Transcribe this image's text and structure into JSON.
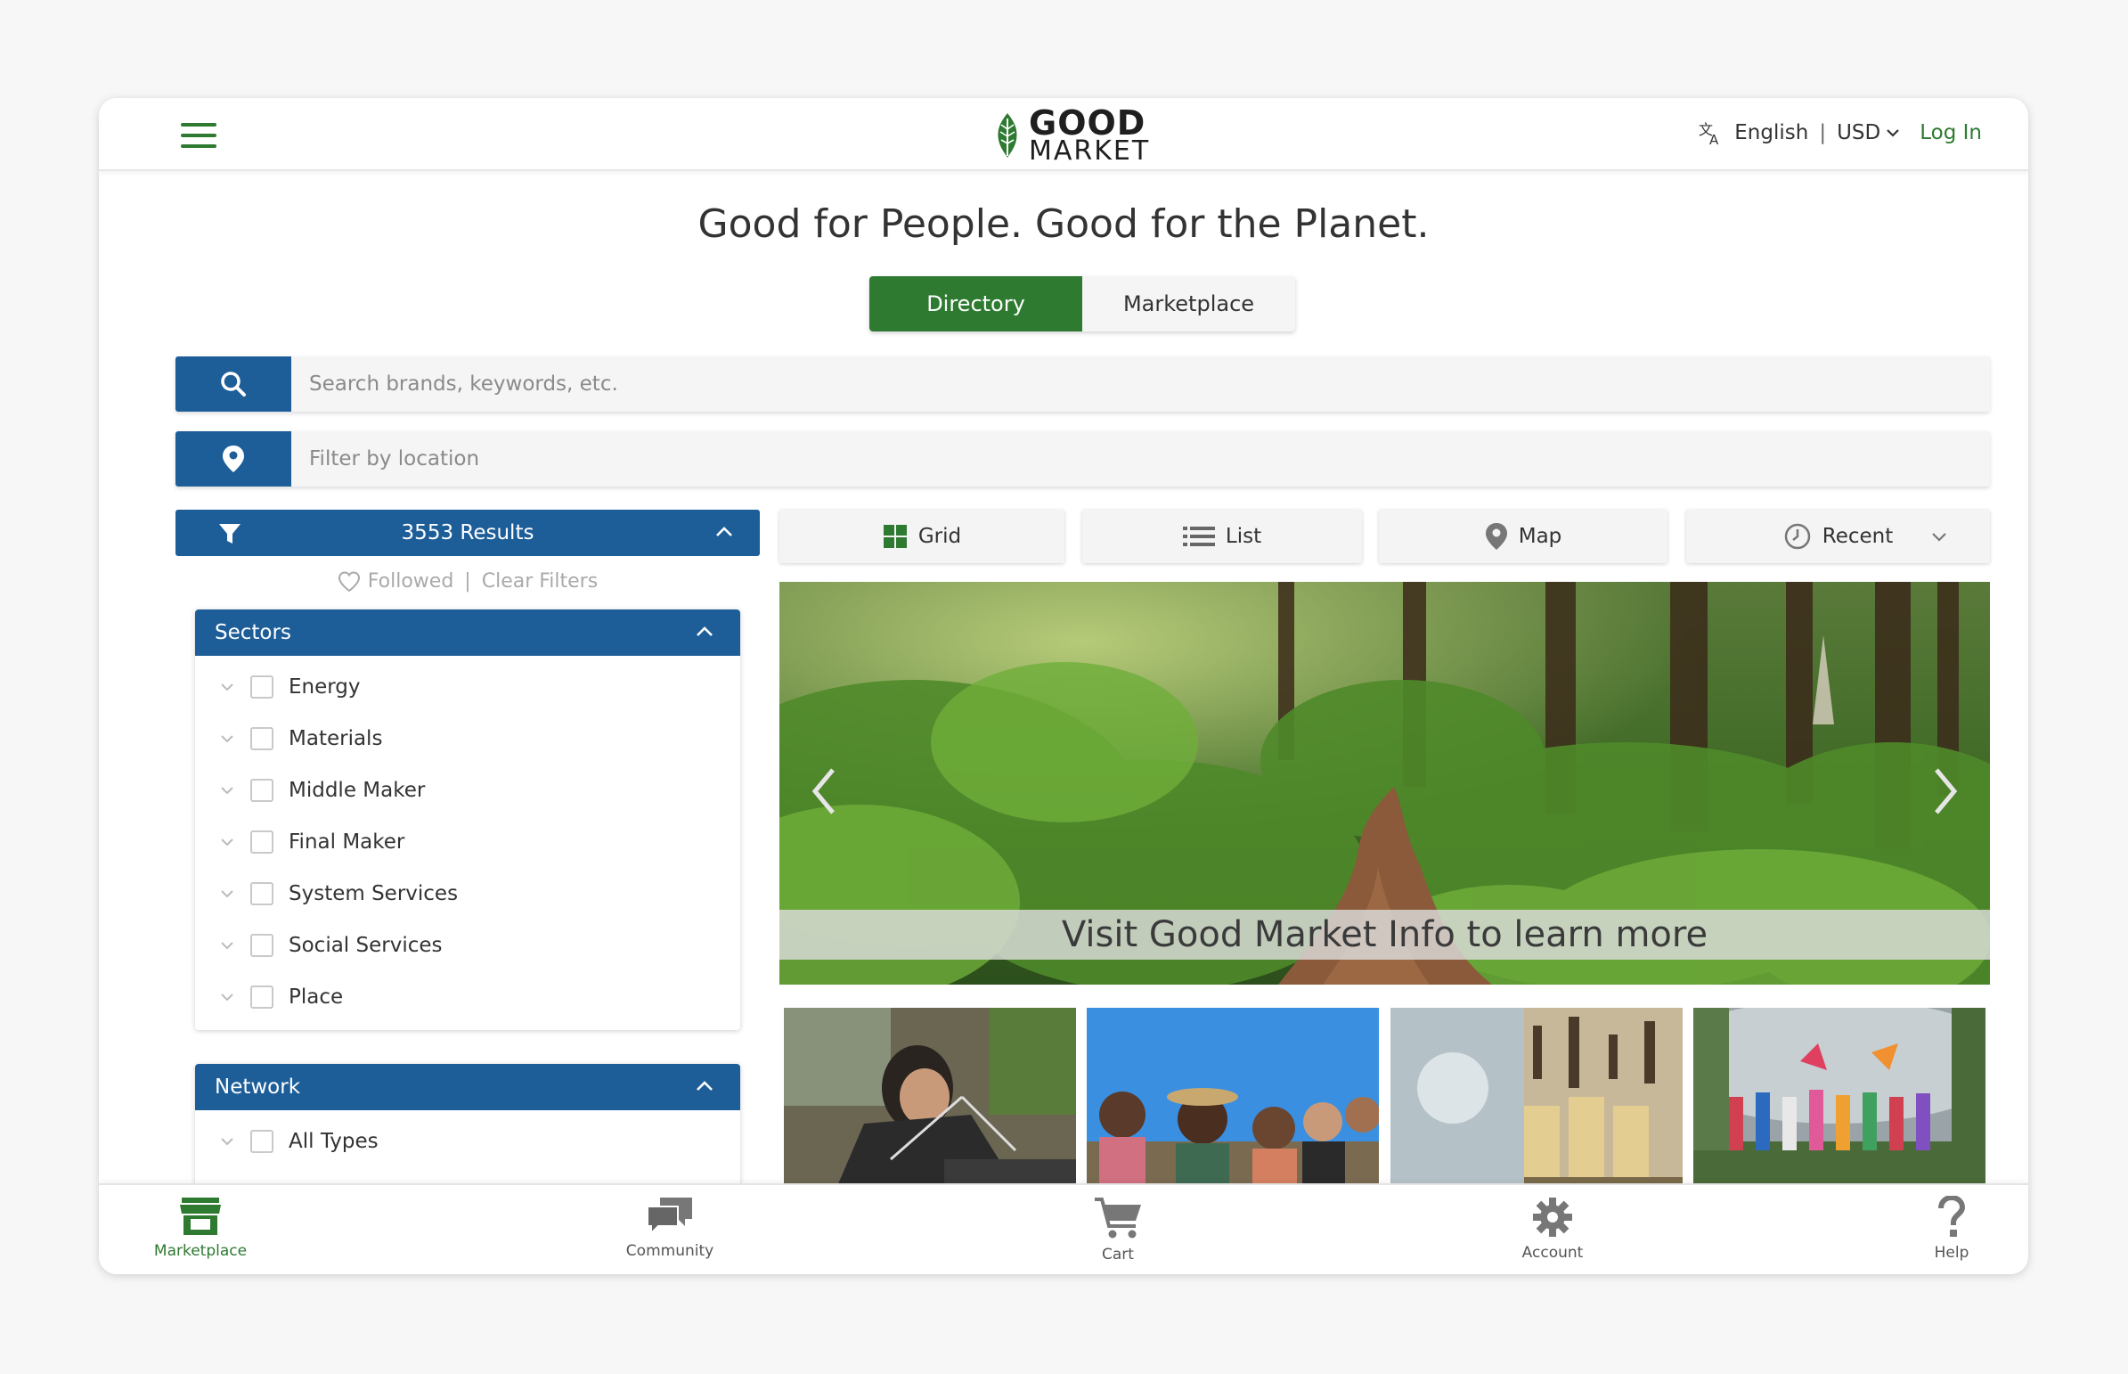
{
  "header": {
    "logo_line1": "GOOD",
    "logo_line2": "MARKET",
    "language": "English",
    "currency": "USD",
    "login_label": "Log In"
  },
  "headline": "Good for People. Good for the Planet.",
  "mode_toggle": {
    "directory_label": "Directory",
    "marketplace_label": "Marketplace",
    "active": "Directory"
  },
  "search": {
    "placeholder": "Search brands, keywords, etc."
  },
  "location": {
    "placeholder": "Filter by location"
  },
  "results": {
    "count_label": "3553 Results",
    "followed_label": "Followed",
    "clear_filters_label": "Clear Filters"
  },
  "sectors": {
    "title": "Sectors",
    "items": [
      {
        "label": "Energy"
      },
      {
        "label": "Materials"
      },
      {
        "label": "Middle Maker"
      },
      {
        "label": "Final Maker"
      },
      {
        "label": "System Services"
      },
      {
        "label": "Social Services"
      },
      {
        "label": "Place"
      }
    ]
  },
  "network": {
    "title": "Network",
    "items": [
      {
        "label": "All Types"
      }
    ]
  },
  "view_tabs": {
    "grid_label": "Grid",
    "list_label": "List",
    "map_label": "Map",
    "sort_label": "Recent"
  },
  "hero": {
    "banner_text": "Visit Good Market Info to learn more"
  },
  "bottom_nav": {
    "marketplace": "Marketplace",
    "community": "Community",
    "cart": "Cart",
    "account": "Account",
    "help": "Help",
    "active": "Marketplace"
  },
  "colors": {
    "brand_green": "#2e7a31",
    "primary_blue": "#1d5e99",
    "page_bg": "#f7f7f7"
  },
  "icons": [
    "hamburger-icon",
    "translate-icon",
    "search-icon",
    "location-pin-icon",
    "funnel-icon",
    "heart-icon",
    "grid-icon",
    "list-icon",
    "map-pin-icon",
    "clock-icon",
    "store-icon",
    "chat-icon",
    "cart-icon",
    "gear-icon",
    "question-icon"
  ]
}
